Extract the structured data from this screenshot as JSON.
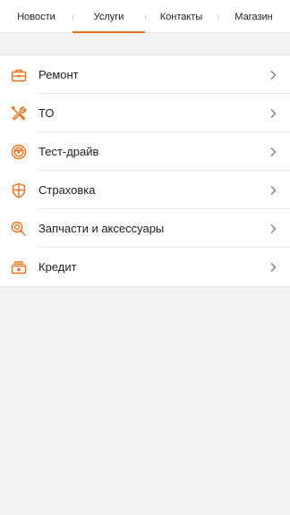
{
  "tabs": [
    {
      "label": "Новости",
      "active": false
    },
    {
      "label": "Услуги",
      "active": true
    },
    {
      "label": "Контакты",
      "active": false
    },
    {
      "label": "Магазин",
      "active": false
    }
  ],
  "services": [
    {
      "label": "Ремонт",
      "icon": "toolbox-icon"
    },
    {
      "label": "ТО",
      "icon": "wrench-screwdriver-icon"
    },
    {
      "label": "Тест-драйв",
      "icon": "steering-wheel-icon"
    },
    {
      "label": "Страховка",
      "icon": "shield-icon"
    },
    {
      "label": "Запчасти и аксессуары",
      "icon": "search-part-icon"
    },
    {
      "label": "Кредит",
      "icon": "cash-stack-icon"
    }
  ],
  "colors": {
    "accent": "#e8711c",
    "chevron": "#8e8e93",
    "background": "#f2f3f5"
  }
}
